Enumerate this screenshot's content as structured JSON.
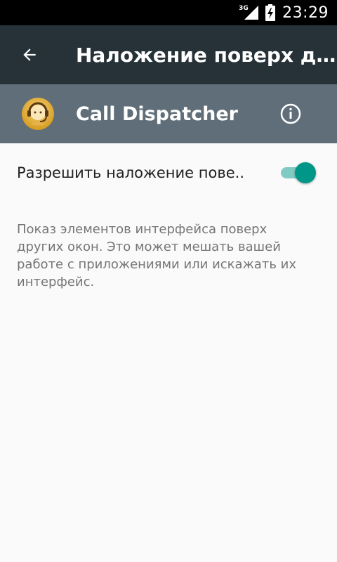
{
  "status_bar": {
    "network": "3G",
    "time": "23:29",
    "icons": [
      "signal-icon",
      "battery-charging-icon"
    ]
  },
  "toolbar": {
    "back_icon": "arrow-back-icon",
    "title": "Наложение поверх др..."
  },
  "app": {
    "name": "Call Dispatcher",
    "icon": "call-dispatcher-app-icon",
    "info_icon": "info-icon"
  },
  "setting": {
    "label": "Разрешить наложение пове..",
    "enabled": true
  },
  "description": "Показ элементов интерфейса поверх других окон. Это может мешать вашей работе с приложениями или искажать их интерфейс.",
  "colors": {
    "status_bar": "#000000",
    "toolbar": "#263238",
    "app_header": "#5f6e78",
    "background": "#fafafa",
    "accent": "#009688",
    "accent_track": "#80cbc4"
  }
}
